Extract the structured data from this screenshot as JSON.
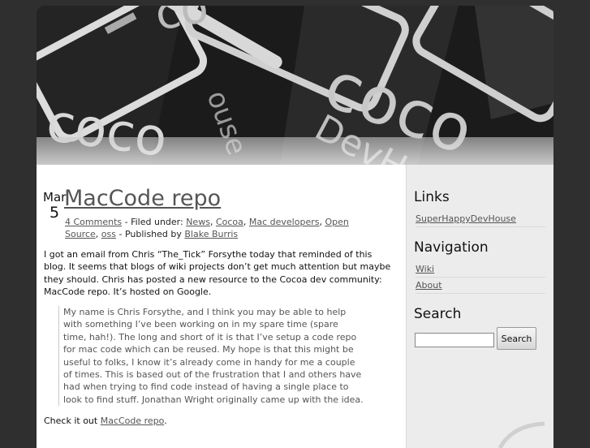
{
  "header": {
    "banner_text": "cocoa DevHouse"
  },
  "post": {
    "date_month": "Mar",
    "date_day": "5",
    "title": "MacCode repo",
    "meta": {
      "comments": "4 Comments",
      "filed_under_label": " - Filed under: ",
      "categories": [
        "News",
        "Cocoa",
        "Mac developers",
        "Open Source",
        "oss"
      ],
      "published_by_label": " - Published by ",
      "author": "Blake Burris"
    },
    "paragraph1": "I got an email from Chris “The_Tick” Forsythe today that reminded of this blog. It seems that blogs of wiki projects don’t get much attention but maybe they should. Chris has posted a new resource to the Cocoa dev community: MacCode repo. It’s hosted on Google.",
    "blockquote": "My name is Chris Forsythe, and I think you may be able to help with something I’ve been working on in my spare time (spare time, hah!). The long and short of it is that I’ve setup a code repo for mac code which can be reused. My hope is that this might be useful to folks, I know it’s already come in handy for me a couple of times. This is based out of the frustration that I and others have had when trying to find code instead of having a single place to look to find stuff. Jonathan Wright originally came up with the idea.",
    "paragraph2_prefix": "Check it out ",
    "paragraph2_link": "MacCode repo",
    "paragraph2_suffix": "."
  },
  "sidebar": {
    "links_heading": "Links",
    "links": [
      "SuperHappyDevHouse"
    ],
    "navigation_heading": "Navigation",
    "navigation": [
      "Wiki",
      "About"
    ],
    "search_heading": "Search",
    "search_value": "",
    "search_button": "Search"
  }
}
